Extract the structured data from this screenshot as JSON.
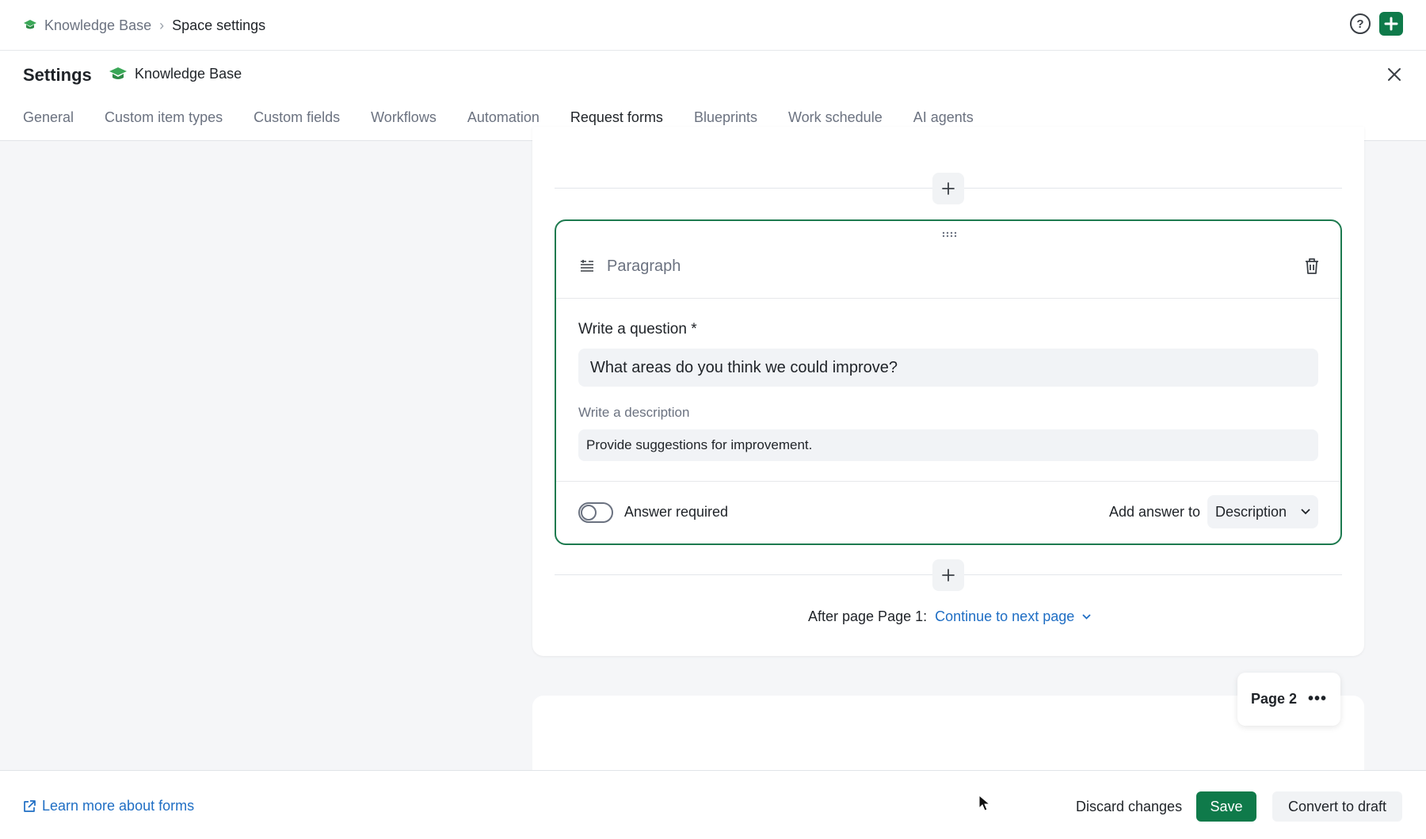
{
  "breadcrumb": {
    "parent": "Knowledge Base",
    "separator": "›",
    "current": "Space settings"
  },
  "header": {
    "help_glyph": "?",
    "plus_glyph": "+"
  },
  "settings": {
    "title": "Settings",
    "space_name": "Knowledge Base",
    "tabs": [
      {
        "label": "General",
        "active": false
      },
      {
        "label": "Custom item types",
        "active": false
      },
      {
        "label": "Custom fields",
        "active": false
      },
      {
        "label": "Workflows",
        "active": false
      },
      {
        "label": "Automation",
        "active": false
      },
      {
        "label": "Request forms",
        "active": true
      },
      {
        "label": "Blueprints",
        "active": false
      },
      {
        "label": "Work schedule",
        "active": false
      },
      {
        "label": "AI agents",
        "active": false
      }
    ]
  },
  "block": {
    "type_label": "Paragraph",
    "question_label": "Write a question *",
    "question_value": "What areas do you think we could improve?",
    "description_label": "Write a description",
    "description_value": "Provide suggestions for improvement.",
    "answer_required_label": "Answer required",
    "answer_required": false,
    "add_answer_label": "Add answer to",
    "add_answer_value": "Description"
  },
  "page_flow": {
    "after_label": "After page Page 1:",
    "after_value": "Continue to next page"
  },
  "page2": {
    "label": "Page 2",
    "more_glyph": "•••"
  },
  "footer": {
    "learn_link": "Learn more about forms",
    "discard": "Discard changes",
    "save": "Save",
    "convert": "Convert to draft"
  },
  "colors": {
    "accent": "#0f7a4a",
    "link": "#1f6ec4",
    "block_border": "#1d7a4f"
  },
  "icons": [
    "graduation-cap-icon",
    "chevron-right-icon",
    "help-icon",
    "plus-icon",
    "close-icon",
    "drag-handle-icon",
    "paragraph-icon",
    "trash-icon",
    "chevron-down-icon",
    "more-icon",
    "external-link-icon"
  ]
}
